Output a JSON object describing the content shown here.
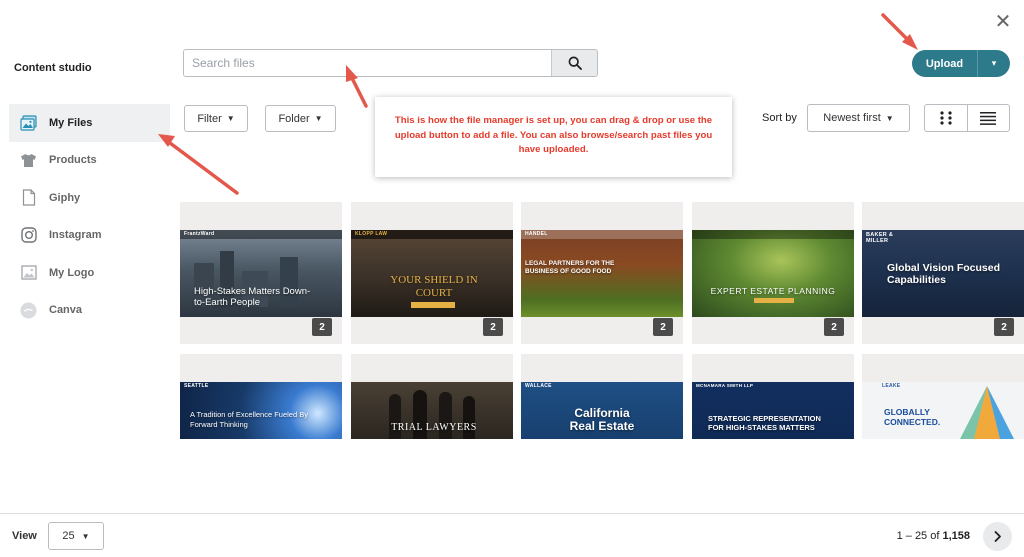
{
  "header": {
    "title": "Content studio",
    "close_symbol": "✕"
  },
  "search": {
    "placeholder": "Search files",
    "icon": "search-icon"
  },
  "upload": {
    "label": "Upload",
    "caret": "▾"
  },
  "sidebar": {
    "items": [
      {
        "label": "My Files",
        "icon": "my-files-icon",
        "active": true
      },
      {
        "label": "Products",
        "icon": "tshirt-icon",
        "active": false
      },
      {
        "label": "Giphy",
        "icon": "document-icon",
        "active": false
      },
      {
        "label": "Instagram",
        "icon": "instagram-icon",
        "active": false
      },
      {
        "label": "My Logo",
        "icon": "image-icon",
        "active": false
      },
      {
        "label": "Canva",
        "icon": "canva-icon",
        "active": false
      }
    ]
  },
  "toolbar": {
    "filter_label": "Filter",
    "folder_label": "Folder",
    "sort_label": "Sort by",
    "sort_value": "Newest first"
  },
  "callout": {
    "text": "This is how the file manager is set up, you can drag & drop or use the upload button to add a file. You can also browse/search past files you have uploaded."
  },
  "files": {
    "row1": [
      {
        "logo": "FrantzWard",
        "caption": "High-Stakes Matters Down-to-Earth People",
        "count": "2",
        "bg": "#4a5864"
      },
      {
        "logo": "KLOPP LAW",
        "caption": "YOUR SHIELD IN COURT",
        "count": "2",
        "bg": "#3b3128"
      },
      {
        "logo": "HANDEL",
        "caption": "LEGAL PARTNERS FOR THE BUSINESS OF GOOD FOOD",
        "count": "2",
        "bg": "#6c3a22"
      },
      {
        "logo": "",
        "caption": "EXPERT ESTATE PLANNING",
        "count": "2",
        "bg": "#3f6b2b"
      },
      {
        "logo": "BAKER & MILLER",
        "caption": "Global Vision Focused Capabilities",
        "count": "2",
        "bg": "#1c2f4c"
      }
    ],
    "row2": [
      {
        "logo": "SEATTLE",
        "caption": "A Tradition of Excellence Fueled By Forward Thinking",
        "bg": "#173a68"
      },
      {
        "logo": "",
        "caption": "TRIAL LAWYERS",
        "bg": "#2b2620"
      },
      {
        "logo": "WALLACE",
        "caption": "California Real Estate",
        "bg": "#17406f"
      },
      {
        "logo": "MCNAMARA SMITH LLP",
        "caption": "STRATEGIC REPRESENTATION FOR HIGH-STAKES MATTERS",
        "bg": "#0f2a55"
      },
      {
        "logo": "LEAKE",
        "caption": "GLOBALLY CONNECTED.",
        "bg": "#f3f4f6"
      }
    ]
  },
  "pagination": {
    "view_label": "View",
    "per_page": "25",
    "range_prefix": "1 – 25 of ",
    "total": "1,158"
  },
  "colors": {
    "accent": "#2d7a8a",
    "callout_text": "#e53b2c",
    "arrow": "#e4584b"
  }
}
